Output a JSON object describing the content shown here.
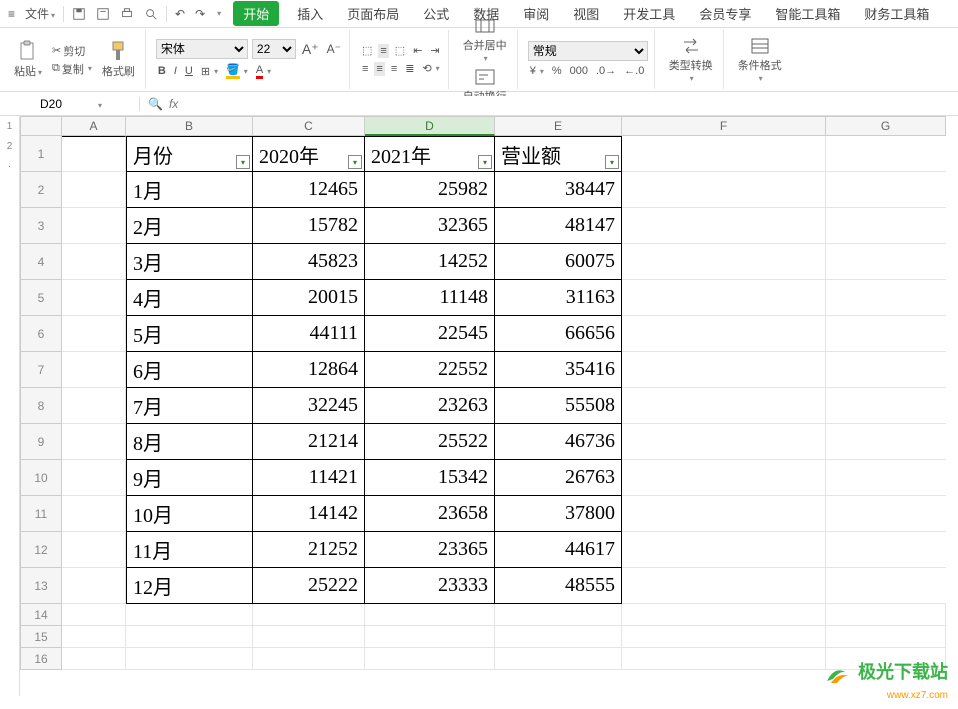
{
  "menu": {
    "file": "文件",
    "tabs": [
      "开始",
      "插入",
      "页面布局",
      "公式",
      "数据",
      "审阅",
      "视图",
      "开发工具",
      "会员专享",
      "智能工具箱",
      "财务工具箱"
    ],
    "active_tab": "开始"
  },
  "ribbon": {
    "paste": "粘贴",
    "cut": "剪切",
    "copy": "复制",
    "format_painter": "格式刷",
    "font_name": "宋体",
    "font_size": "22",
    "merge": "合并居中",
    "wrap": "自动换行",
    "numfmt": "常规",
    "type_convert": "类型转换",
    "cond_fmt": "条件格式"
  },
  "namebox": "D20",
  "columns": [
    "A",
    "B",
    "C",
    "D",
    "E",
    "F",
    "G"
  ],
  "headers": {
    "B": "月份",
    "C": "2020年",
    "D": "2021年",
    "E": "营业额"
  },
  "rows": [
    {
      "n": 1,
      "B": "月份",
      "C": "2020年",
      "D": "2021年",
      "E": "营业额",
      "hdr": true
    },
    {
      "n": 2,
      "B": "1月",
      "C": "12465",
      "D": "25982",
      "E": "38447"
    },
    {
      "n": 3,
      "B": "2月",
      "C": "15782",
      "D": "32365",
      "E": "48147"
    },
    {
      "n": 4,
      "B": "3月",
      "C": "45823",
      "D": "14252",
      "E": "60075"
    },
    {
      "n": 5,
      "B": "4月",
      "C": "20015",
      "D": "11148",
      "E": "31163"
    },
    {
      "n": 6,
      "B": "5月",
      "C": "44111",
      "D": "22545",
      "E": "66656"
    },
    {
      "n": 7,
      "B": "6月",
      "C": "12864",
      "D": "22552",
      "E": "35416"
    },
    {
      "n": 8,
      "B": "7月",
      "C": "32245",
      "D": "23263",
      "E": "55508"
    },
    {
      "n": 9,
      "B": "8月",
      "C": "21214",
      "D": "25522",
      "E": "46736"
    },
    {
      "n": 10,
      "B": "9月",
      "C": "11421",
      "D": "15342",
      "E": "26763"
    },
    {
      "n": 11,
      "B": "10月",
      "C": "14142",
      "D": "23658",
      "E": "37800"
    },
    {
      "n": 12,
      "B": "11月",
      "C": "21252",
      "D": "23365",
      "E": "44617"
    },
    {
      "n": 13,
      "B": "12月",
      "C": "25222",
      "D": "23333",
      "E": "48555"
    }
  ],
  "empty_rows": [
    14,
    15,
    16
  ],
  "selected_col": "D",
  "watermark": {
    "title": "极光下载站",
    "url": "www.xz7.com"
  },
  "left_strip": [
    "1",
    "2"
  ]
}
